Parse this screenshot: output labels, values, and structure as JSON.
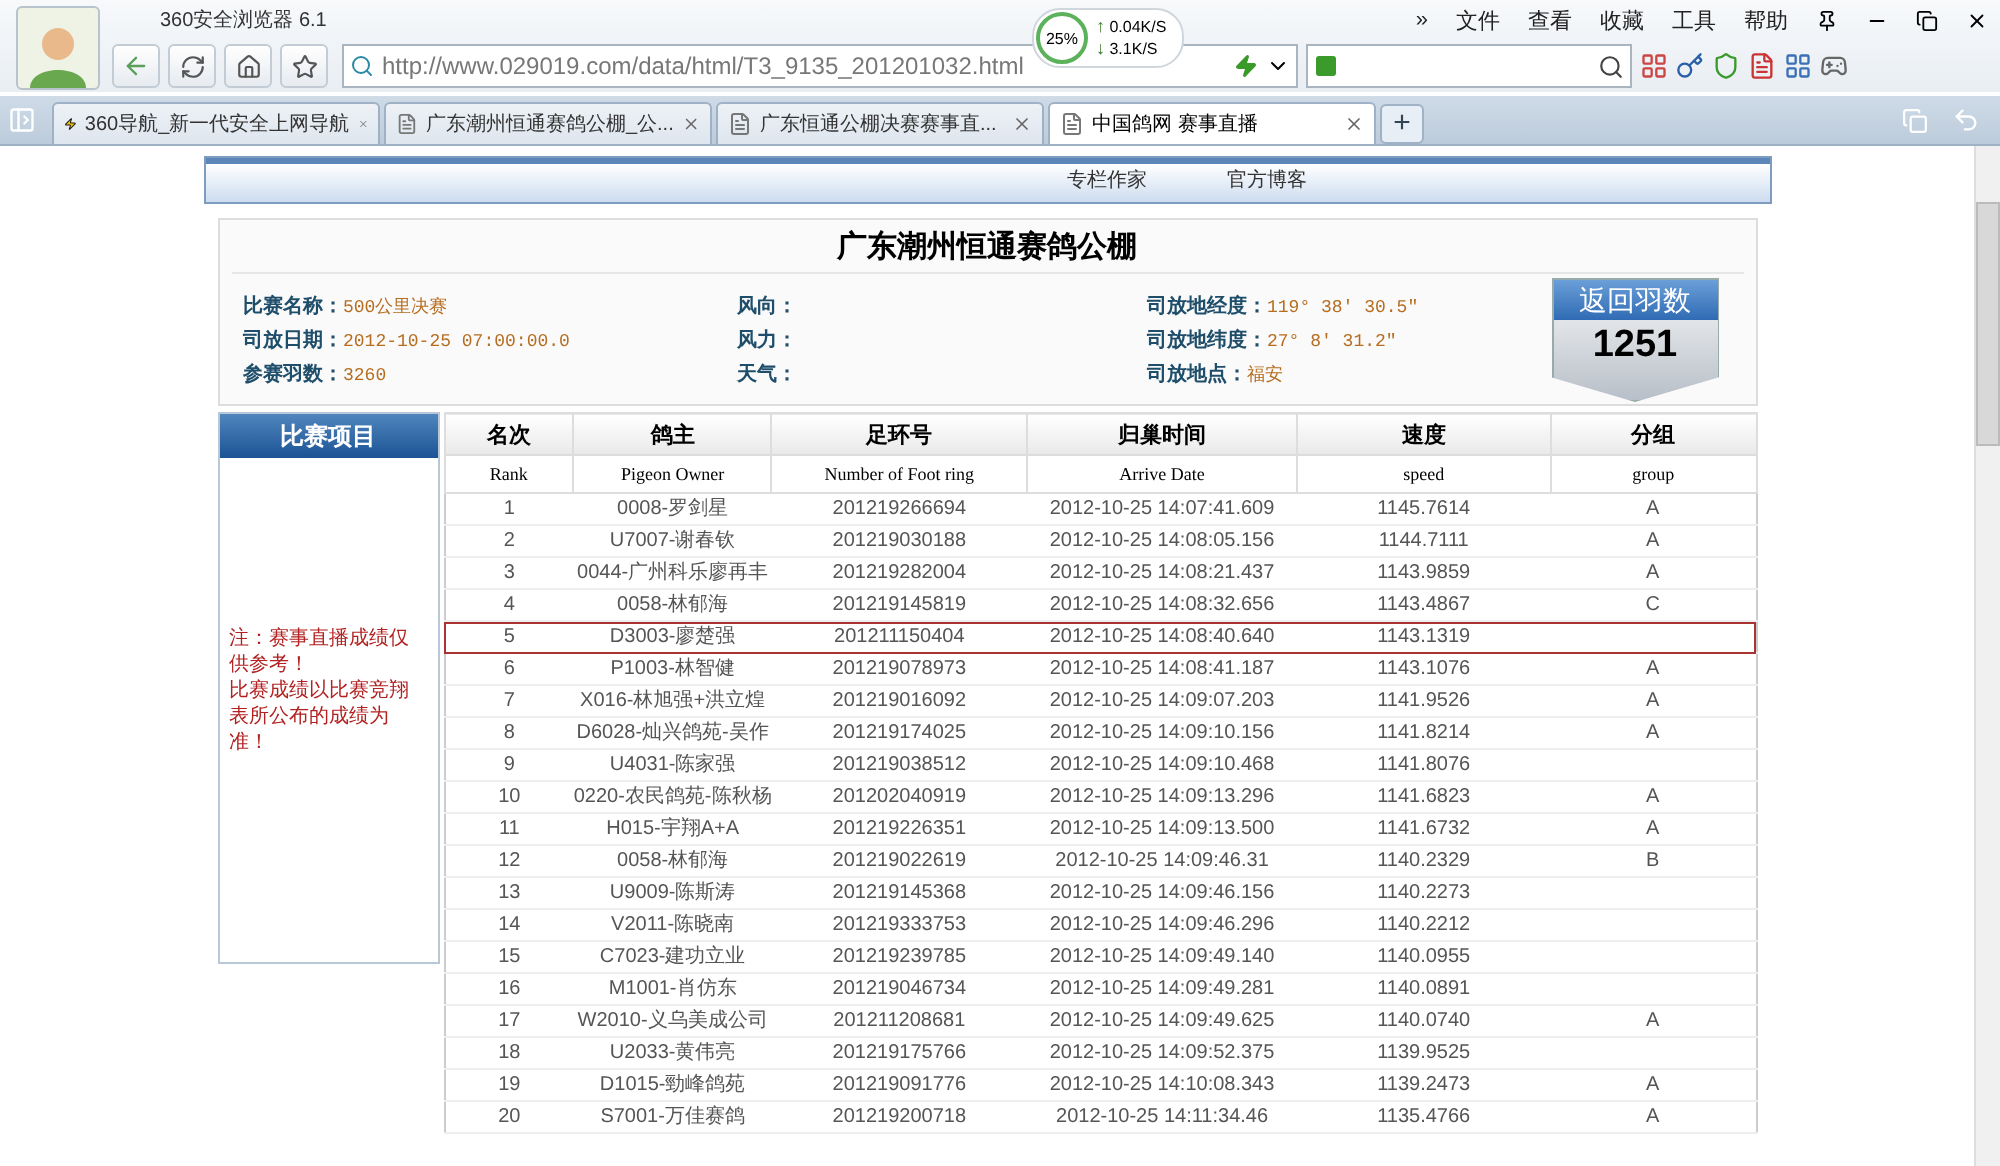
{
  "browser": {
    "title": "360安全浏览器",
    "version": "6.1",
    "url": "http://www.029019.com/data/html/T3_9135_201201032.html",
    "net": {
      "percent": "25%",
      "up_arrow": "↑",
      "up": "0.04K/S",
      "down_arrow": "↓",
      "down": "3.1K/S"
    },
    "menu": [
      "»",
      "文件",
      "查看",
      "收藏",
      "工具",
      "帮助"
    ],
    "tabs": [
      {
        "label": "360导航_新一代安全上网导航",
        "selected": false,
        "kind": "nav"
      },
      {
        "label": "广东潮州恒通赛鸽公棚_公...",
        "selected": false,
        "kind": "page"
      },
      {
        "label": "广东恒通公棚决赛赛事直...",
        "selected": false,
        "kind": "page"
      },
      {
        "label": "中国鸽网  赛事直播",
        "selected": true,
        "kind": "page"
      }
    ],
    "new_tab": "+"
  },
  "page": {
    "nav_links": [
      "专栏作家",
      "官方博客"
    ],
    "title": "广东潮州恒通赛鸽公棚",
    "fields": [
      {
        "label": "比赛名称：",
        "value": "500公里决赛"
      },
      {
        "label": "风向："
      },
      {
        "label": "司放地经度：",
        "value": "119° 38′ 30.5″"
      },
      {
        "label": "司放日期：",
        "value": "2012-10-25 07:00:00.0"
      },
      {
        "label": "风力："
      },
      {
        "label": "司放地纬度：",
        "value": "27° 8′ 31.2″"
      },
      {
        "label": "参赛羽数：",
        "value": "3260"
      },
      {
        "label": "天气："
      },
      {
        "label": "司放地点：",
        "value": "福安"
      }
    ],
    "returned": {
      "label": "返回羽数",
      "count": "1251"
    },
    "side": {
      "title": "比赛项目",
      "notes": [
        "注：赛事直播成绩仅供参考！",
        "比赛成绩以比赛竞翔表所公布的成绩为准！"
      ]
    },
    "table": {
      "columns": [
        {
          "zh": "名次",
          "en": "Rank"
        },
        {
          "zh": "鸽主",
          "en": "Pigeon Owner"
        },
        {
          "zh": "足环号",
          "en": "Number of Foot ring"
        },
        {
          "zh": "归巢时间",
          "en": "Arrive Date"
        },
        {
          "zh": "速度",
          "en": "speed"
        },
        {
          "zh": "分组",
          "en": "group"
        }
      ],
      "rows": [
        {
          "cells": [
            "1",
            "0008-罗剑星",
            "201219266694",
            "2012-10-25 14:07:41.609",
            "1145.7614",
            "A"
          ],
          "selected": false
        },
        {
          "cells": [
            "2",
            "U7007-谢春钦",
            "201219030188",
            "2012-10-25 14:08:05.156",
            "1144.7111",
            "A"
          ],
          "selected": false
        },
        {
          "cells": [
            "3",
            "0044-广州科乐廖再丰",
            "201219282004",
            "2012-10-25 14:08:21.437",
            "1143.9859",
            "A"
          ],
          "selected": false
        },
        {
          "cells": [
            "4",
            "0058-林郁海",
            "201219145819",
            "2012-10-25 14:08:32.656",
            "1143.4867",
            "C"
          ],
          "selected": false
        },
        {
          "cells": [
            "5",
            "D3003-廖楚强",
            "201211150404",
            "2012-10-25 14:08:40.640",
            "1143.1319"
          ],
          "selected": true
        },
        {
          "cells": [
            "6",
            "P1003-林智健",
            "201219078973",
            "2012-10-25 14:08:41.187",
            "1143.1076",
            "A"
          ],
          "selected": false
        },
        {
          "cells": [
            "7",
            "X016-林旭强+洪立煌",
            "201219016092",
            "2012-10-25 14:09:07.203",
            "1141.9526",
            "A"
          ],
          "selected": false
        },
        {
          "cells": [
            "8",
            "D6028-灿兴鸽苑-吴作",
            "201219174025",
            "2012-10-25 14:09:10.156",
            "1141.8214",
            "A"
          ],
          "selected": false
        },
        {
          "cells": [
            "9",
            "U4031-陈家强",
            "201219038512",
            "2012-10-25 14:09:10.468",
            "1141.8076"
          ],
          "selected": false
        },
        {
          "cells": [
            "10",
            "0220-农民鸽苑-陈秋杨",
            "201202040919",
            "2012-10-25 14:09:13.296",
            "1141.6823",
            "A"
          ],
          "selected": false
        },
        {
          "cells": [
            "11",
            "H015-宇翔A+A",
            "201219226351",
            "2012-10-25 14:09:13.500",
            "1141.6732",
            "A"
          ],
          "selected": false
        },
        {
          "cells": [
            "12",
            "0058-林郁海",
            "201219022619",
            "2012-10-25 14:09:46.31",
            "1140.2329",
            "B"
          ],
          "selected": false
        },
        {
          "cells": [
            "13",
            "U9009-陈斯涛",
            "201219145368",
            "2012-10-25 14:09:46.156",
            "1140.2273"
          ],
          "selected": false
        },
        {
          "cells": [
            "14",
            "V2011-陈晓南",
            "201219333753",
            "2012-10-25 14:09:46.296",
            "1140.2212"
          ],
          "selected": false
        },
        {
          "cells": [
            "15",
            "C7023-建功立业",
            "201219239785",
            "2012-10-25 14:09:49.140",
            "1140.0955"
          ],
          "selected": false
        },
        {
          "cells": [
            "16",
            "M1001-肖仿东",
            "201219046734",
            "2012-10-25 14:09:49.281",
            "1140.0891"
          ],
          "selected": false
        },
        {
          "cells": [
            "17",
            "W2010-义乌美成公司",
            "201211208681",
            "2012-10-25 14:09:49.625",
            "1140.0740",
            "A"
          ],
          "selected": false
        },
        {
          "cells": [
            "18",
            "U2033-黄伟亮",
            "201219175766",
            "2012-10-25 14:09:52.375",
            "1139.9525"
          ],
          "selected": false
        },
        {
          "cells": [
            "19",
            "D1015-勁峰鸽苑",
            "201219091776",
            "2012-10-25 14:10:08.343",
            "1139.2473",
            "A"
          ],
          "selected": false
        },
        {
          "cells": [
            "20",
            "S7001-万佳赛鸽",
            "201219200718",
            "2012-10-25 14:11:34.46",
            "1135.4766",
            "A"
          ],
          "selected": false
        }
      ]
    }
  }
}
